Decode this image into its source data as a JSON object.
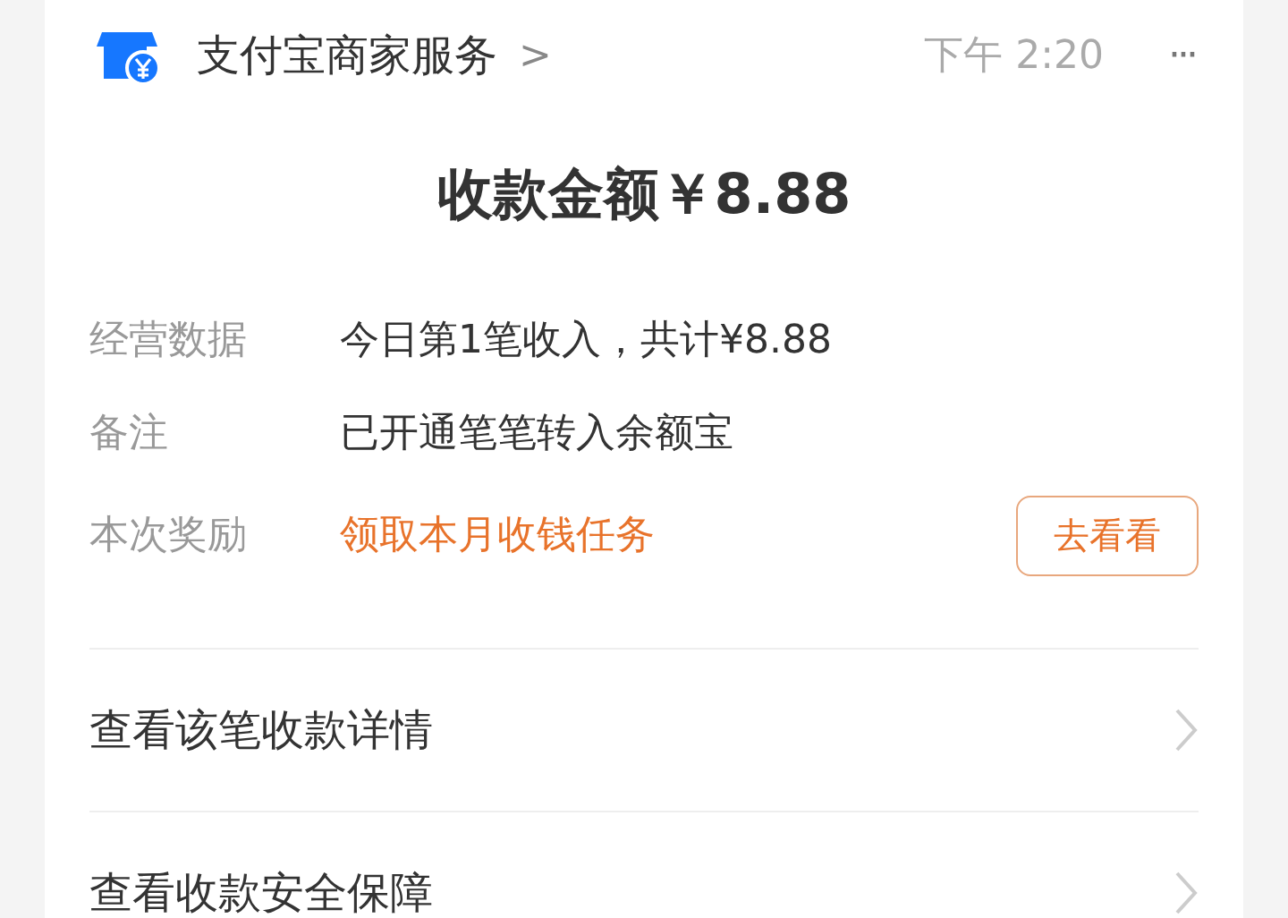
{
  "header": {
    "title": "支付宝商家服务",
    "chevron": ">",
    "time": "下午 2:20",
    "more": "···"
  },
  "amount": {
    "label": "收款金额",
    "value": "￥8.88"
  },
  "details": [
    {
      "label": "经营数据",
      "value": "今日第1笔收入，共计¥8.88",
      "kind": "plain"
    },
    {
      "label": "备注",
      "value": "已开通笔笔转入余额宝",
      "kind": "plain"
    },
    {
      "label": "本次奖励",
      "value": "领取本月收钱任务",
      "kind": "action",
      "button": "去看看"
    }
  ],
  "links": [
    {
      "label": "查看该笔收款详情"
    },
    {
      "label": "查看收款安全保障"
    }
  ]
}
